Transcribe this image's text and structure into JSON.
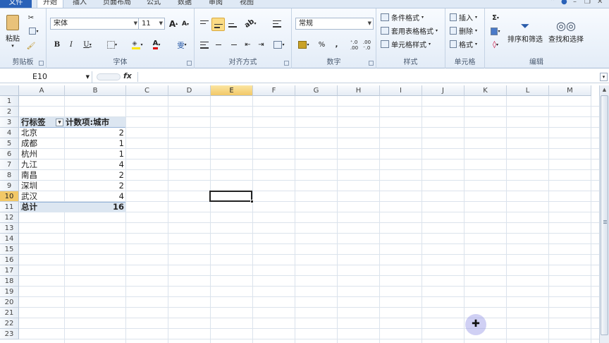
{
  "tabs": {
    "file": "文件",
    "items": [
      "开始",
      "插入",
      "页面布局",
      "公式",
      "数据",
      "审阅",
      "视图"
    ]
  },
  "ribbon": {
    "clipboard": {
      "paste": "粘贴",
      "group_label": "剪贴板"
    },
    "font": {
      "name": "宋体",
      "size": "11",
      "bold": "B",
      "italic": "I",
      "underline": "U",
      "grow": "A",
      "shrink": "A",
      "phonetic": "雯",
      "group_label": "字体"
    },
    "alignment": {
      "group_label": "对齐方式"
    },
    "number": {
      "format": "常规",
      "percent": "%",
      "comma": ",",
      "group_label": "数字"
    },
    "styles": {
      "conditional": "条件格式",
      "table": "套用表格格式",
      "cell": "单元格样式",
      "group_label": "样式"
    },
    "cells": {
      "insert": "插入",
      "delete": "删除",
      "format": "格式",
      "group_label": "单元格"
    },
    "editing": {
      "sum": "Σ",
      "sort": "排序和筛选",
      "find": "查找和选择",
      "group_label": "编辑"
    }
  },
  "formula_bar": {
    "name_box": "E10",
    "fx": "fx",
    "formula": ""
  },
  "sheet": {
    "columns": [
      "A",
      "B",
      "C",
      "D",
      "E",
      "F",
      "G",
      "H",
      "I",
      "J",
      "K",
      "L",
      "M"
    ],
    "selected_column": "E",
    "rows": [
      "1",
      "2",
      "3",
      "4",
      "5",
      "6",
      "7",
      "8",
      "9",
      "10",
      "11",
      "12",
      "13",
      "14",
      "15",
      "16",
      "17",
      "18",
      "19",
      "20",
      "21",
      "22",
      "23"
    ],
    "selected_row": "10"
  },
  "pivot": {
    "row_label": "行标签",
    "value_label": "计数项:城市",
    "rows": [
      {
        "city": "北京",
        "count": "2"
      },
      {
        "city": "成都",
        "count": "1"
      },
      {
        "city": "杭州",
        "count": "1"
      },
      {
        "city": "九江",
        "count": "4"
      },
      {
        "city": "南昌",
        "count": "2"
      },
      {
        "city": "深圳",
        "count": "2"
      },
      {
        "city": "武汉",
        "count": "4"
      }
    ],
    "total_label": "总计",
    "total_value": "16"
  },
  "colors": {
    "accent": "#2a62b8",
    "header_fill": "#dce6f1",
    "selection": "#f2c867"
  }
}
